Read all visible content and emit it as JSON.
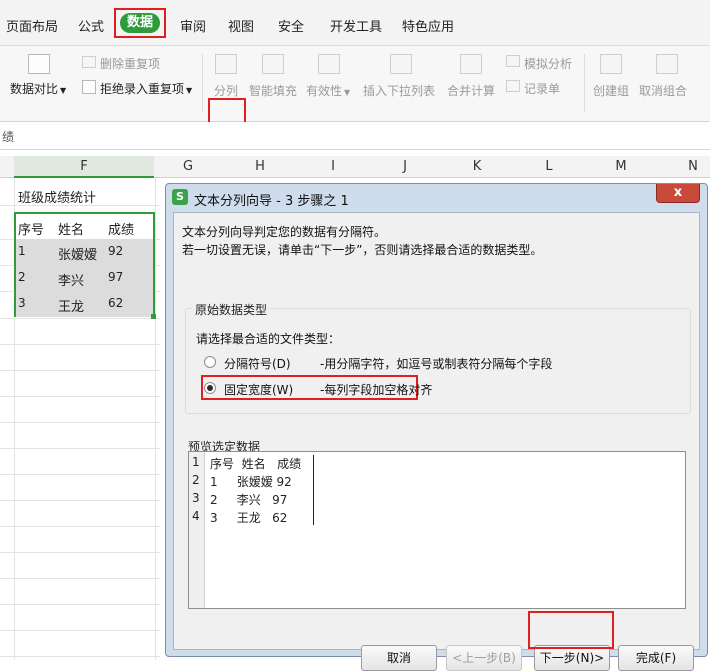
{
  "menu": {
    "items": [
      "页面布局",
      "公式",
      "数据",
      "审阅",
      "视图",
      "安全",
      "开发工具",
      "特色应用"
    ]
  },
  "ribbon": {
    "data_compare": "数据对比",
    "remove_dup": "删除重复项",
    "reject_dup": "拒绝录入重复项",
    "split": "分列",
    "smart_fill": "智能填充",
    "validity": "有效性",
    "insert_dropdown": "插入下拉列表",
    "merge_calc": "合并计算",
    "simulate": "模拟分析",
    "record": "记录单",
    "create_group": "创建组",
    "ungroup": "取消组合"
  },
  "formula_bar": {
    "text": "绩"
  },
  "sheet": {
    "columns": [
      "F",
      "G",
      "H",
      "I",
      "J",
      "K",
      "L",
      "M",
      "N"
    ],
    "title": "班级成绩统计",
    "headers": [
      "序号",
      "姓名",
      "成绩"
    ],
    "rows": [
      [
        "1",
        "张嫒嫒",
        "92"
      ],
      [
        "2",
        "李兴",
        "97"
      ],
      [
        "3",
        "王龙",
        "62"
      ]
    ]
  },
  "dialog": {
    "title": "文本分列向导 - 3 步骤之 1",
    "close": "x",
    "intro1": "文本分列向导判定您的数据有分隔符。",
    "intro2": "若一切设置无误，请单击“下一步”，否则请选择最合适的数据类型。",
    "group_legend": "原始数据类型",
    "choose_prompt": "请选择最合适的文件类型：",
    "opt_delimited": "分隔符号(D)",
    "opt_delimited_desc": "-用分隔字符，如逗号或制表符分隔每个字段",
    "opt_fixed": "固定宽度(W)",
    "opt_fixed_desc": "-每列字段加空格对齐",
    "preview_legend": "预览选定数据",
    "preview_lines": [
      {
        "num": "1",
        "text": "序号  姓名   成绩"
      },
      {
        "num": "2",
        "text": "1     张嫒嫒 92"
      },
      {
        "num": "3",
        "text": "2     李兴   97"
      },
      {
        "num": "4",
        "text": "3     王龙   62"
      }
    ],
    "btn_cancel": "取消",
    "btn_prev": "<上一步(B)",
    "btn_next": "下一步(N)>",
    "btn_finish": "完成(F)"
  }
}
